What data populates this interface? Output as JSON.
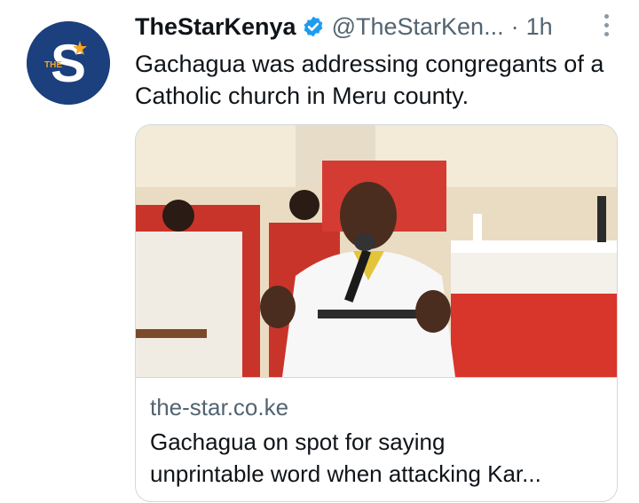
{
  "tweet": {
    "display_name": "TheStarKenya",
    "handle": "@TheStarKen...",
    "separator": "·",
    "time": "1h",
    "text": "Gachagua was addressing congregants of a Catholic church in Meru county.",
    "avatar_logo": {
      "letter": "S",
      "small_text": "THE"
    },
    "verified_icon": "verified-badge-icon",
    "more_icon": "more-options-icon"
  },
  "card": {
    "domain": "the-star.co.ke",
    "title": "Gachagua on spot for saying\nunprintable word when attacking Kar..."
  },
  "colors": {
    "avatar_bg": "#1c3f7d",
    "verified": "#1d9bf0",
    "secondary_text": "#536471",
    "border": "#cfd9de"
  }
}
